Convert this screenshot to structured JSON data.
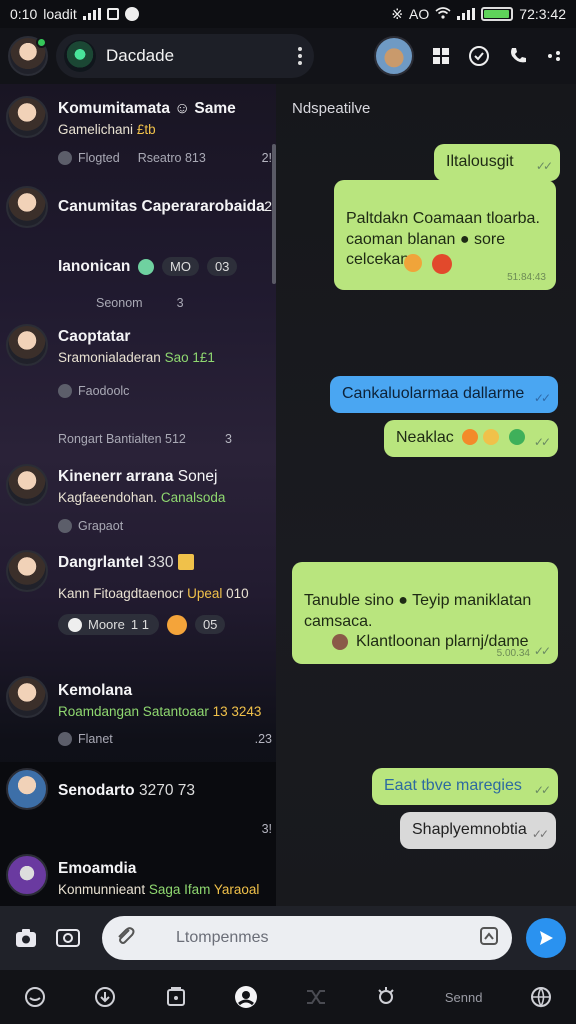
{
  "status_bar": {
    "time_left": "0:10",
    "carrier": "loadit",
    "time_right": "72:3:42",
    "network": "AO",
    "battery_percent": 95
  },
  "header": {
    "title": "Dacdade"
  },
  "chats": [
    {
      "title": "Komumitamata ☺ Same",
      "subtitle": "Gamelichani",
      "subtitle_tag": "£tb",
      "meta": "Flogted",
      "meta2": "Rseatro 813",
      "num": "2!"
    },
    {
      "title": "Canumitas Caperararobaida",
      "num": "2"
    },
    {
      "title": "Ianonican",
      "badge": "MO",
      "badge2": "03",
      "meta": "Seonom",
      "meta_num": "3"
    },
    {
      "title": "Caoptatar",
      "subtitle": "Sramonialaderan",
      "subtitle_tag": "Sao 1£1",
      "meta": "Faodoolc"
    },
    {
      "preview": "Rongart  Bantialten 512",
      "num": "3"
    },
    {
      "title": "Kinenerr arrana",
      "title_tag": "Sonej",
      "subtitle": "Kagfaeendohan.",
      "subtitle_tag": "Canalsoda",
      "meta": "Grapaot"
    },
    {
      "title": "Dangrlantel",
      "title_num": "330",
      "subtitle": "Kann Fitoagdtaenocr",
      "subtitle_tag": "Upeal",
      "subtitle_num": "010",
      "pill": "Moore",
      "pill_num": "1 1",
      "pill_badge": "05"
    },
    {
      "title": "Kemolana",
      "subtitle": "Roamdangan Satantoaar",
      "subtitle_tag": "13 3243",
      "meta": "Flanet",
      "num": ".23"
    },
    {
      "title": "Senodarto",
      "title_num": "3270",
      "title_num2": "73",
      "num": "3!"
    },
    {
      "title": "Emoamdia",
      "subtitle": "Konmunnieant",
      "subtitle_tag": "Saga Ifam",
      "subtitle_tag2": "Yaraoal"
    }
  ],
  "conversation": {
    "header": "Ndspeatilve",
    "messages": [
      {
        "text": "Iltalousgit",
        "color": "#b9e57e"
      },
      {
        "text": "Paltdakn Coamaan tloarba.\ncaoman blanan ● sore\ncelcekan",
        "time": "51:84:43",
        "color": "#b9e57e"
      },
      {
        "text": "Cankaluolarmaa dallarme",
        "color": "#4aa6f2"
      },
      {
        "text": "Neaklac",
        "color": "#b9e57e"
      },
      {
        "text": "Tanuble sino ● Teyip maniklatan\ncamsaca.",
        "text2": "Klantloonan plarnj/dame",
        "time": "5.00.34",
        "color": "#b9e57e"
      },
      {
        "text": "Eaat tbve maregies",
        "color": "#b9e57e"
      },
      {
        "text": "Shaplyemnobtia",
        "color": "#d9d9d9"
      }
    ]
  },
  "input": {
    "placeholder": "Ltompenmes"
  },
  "bottom_nav": {
    "items": [
      {
        "icon": "chat-icon"
      },
      {
        "icon": "download-icon"
      },
      {
        "icon": "gallery-icon"
      },
      {
        "icon": "profile-icon"
      },
      {
        "icon": "shuffle-icon"
      },
      {
        "icon": "award-icon"
      },
      {
        "label": "Sennd"
      },
      {
        "icon": "globe-icon"
      }
    ]
  }
}
